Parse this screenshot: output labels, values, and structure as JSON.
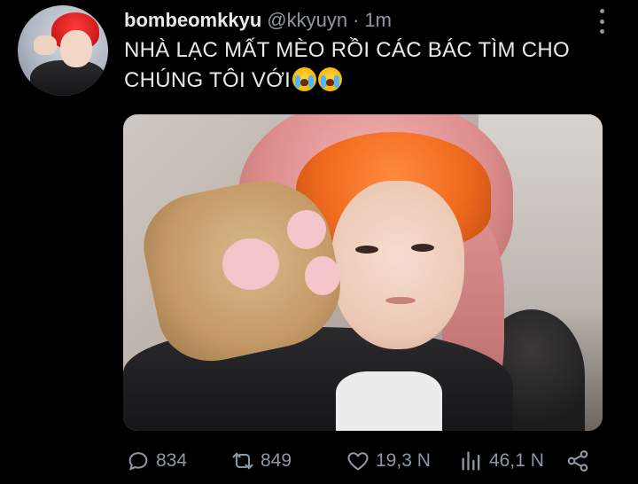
{
  "tweet": {
    "display_name": "bombeomkkyu",
    "handle": "@kkyuyn",
    "separator": "·",
    "time": "1m",
    "text": "NHÀ LẠC MẤT MÈO RỒI CÁC BÁC TÌM CHO CHÚNG TÔI VỚI",
    "emojis": [
      "loudly-crying-face",
      "loudly-crying-face"
    ]
  },
  "actions": {
    "replies": "834",
    "retweets": "849",
    "likes": "19,3 N",
    "views": "46,1 N"
  },
  "icons": {
    "reply": "speech-bubble-icon",
    "retweet": "retweet-icon",
    "like": "heart-icon",
    "views": "bar-chart-icon",
    "share": "share-icon",
    "more": "more-vertical-icon"
  },
  "colors": {
    "background": "#000000",
    "text": "#e7e9ea",
    "secondary": "#8b98a5"
  }
}
